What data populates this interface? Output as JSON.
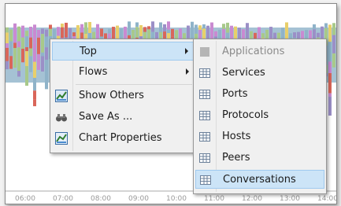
{
  "axis_labels": [
    "06:00",
    "07:00",
    "08:00",
    "09:00",
    "10:00",
    "11:00",
    "12:00",
    "13:00",
    "14:00"
  ],
  "context_menu": {
    "items": [
      {
        "label": "Top",
        "icon": "none",
        "submenu": true,
        "highlighted": true
      },
      {
        "label": "Flows",
        "icon": "none",
        "submenu": true
      },
      {
        "label": "Show Others",
        "icon": "chart-check-icon",
        "checked": true
      },
      {
        "label": "Save As ...",
        "icon": "binoculars-icon"
      },
      {
        "label": "Chart Properties",
        "icon": "chart-properties-icon"
      }
    ]
  },
  "submenu": {
    "items": [
      {
        "label": "Applications",
        "icon": "grid-icon",
        "disabled": true
      },
      {
        "label": "Services",
        "icon": "grid-icon"
      },
      {
        "label": "Ports",
        "icon": "grid-icon"
      },
      {
        "label": "Protocols",
        "icon": "grid-icon"
      },
      {
        "label": "Hosts",
        "icon": "grid-icon"
      },
      {
        "label": "Peers",
        "icon": "grid-icon"
      },
      {
        "label": "Conversations",
        "icon": "grid-icon",
        "highlighted": true
      }
    ]
  },
  "colors": {
    "highlight": "#cce4f7",
    "highlight_border": "#9fc9ef",
    "menu_bg": "#f0f0f0",
    "chart_blue": "#8fb3c9",
    "chart_green": "#a8c98a",
    "chart_red": "#d9665a",
    "chart_yellow": "#e8cf6b"
  }
}
